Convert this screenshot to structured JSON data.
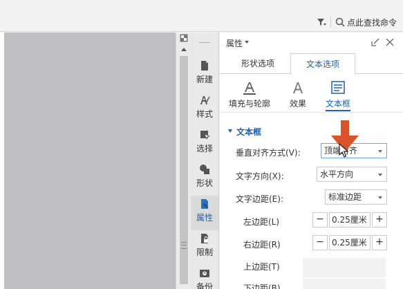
{
  "topbar": {
    "search_label": "点此查找命令"
  },
  "sidebar": {
    "items": [
      {
        "label": "新建",
        "icon": "document-icon"
      },
      {
        "label": "样式",
        "icon": "style-icon"
      },
      {
        "label": "选择",
        "icon": "select-icon"
      },
      {
        "label": "形状",
        "icon": "shape-icon"
      },
      {
        "label": "属性",
        "icon": "property-icon"
      },
      {
        "label": "限制",
        "icon": "lock-document-icon"
      },
      {
        "label": "备份",
        "icon": "backup-icon"
      }
    ],
    "active_index": 4
  },
  "panel": {
    "title": "属性",
    "tabs": [
      "形状选项",
      "文本选项"
    ],
    "active_tab": 1,
    "subtabs": [
      "填充与轮廓",
      "效果",
      "文本框"
    ],
    "active_subtab": 2,
    "section_title": "文本框",
    "fields": {
      "vertical_align": {
        "label": "垂直对齐方式(V):",
        "value": "顶端对齐"
      },
      "text_direction": {
        "label": "文字方向(X):",
        "value": "水平方向"
      },
      "text_margin": {
        "label": "文字边距(E):",
        "value": "标准边距"
      },
      "left_margin": {
        "label": "左边距(L)",
        "value": "0.25厘米"
      },
      "right_margin": {
        "label": "右边距(R)",
        "value": "0.25厘米"
      },
      "top_margin": {
        "label": "上边距(T)",
        "value": ""
      },
      "bottom_margin": {
        "label": "下边距(B)",
        "value": ""
      }
    },
    "stepper_minus": "−",
    "stepper_plus": "+"
  },
  "colors": {
    "accent": "#1f5fa8",
    "arrow": "#d9542b",
    "doc_bg": "#bfbfc1"
  }
}
